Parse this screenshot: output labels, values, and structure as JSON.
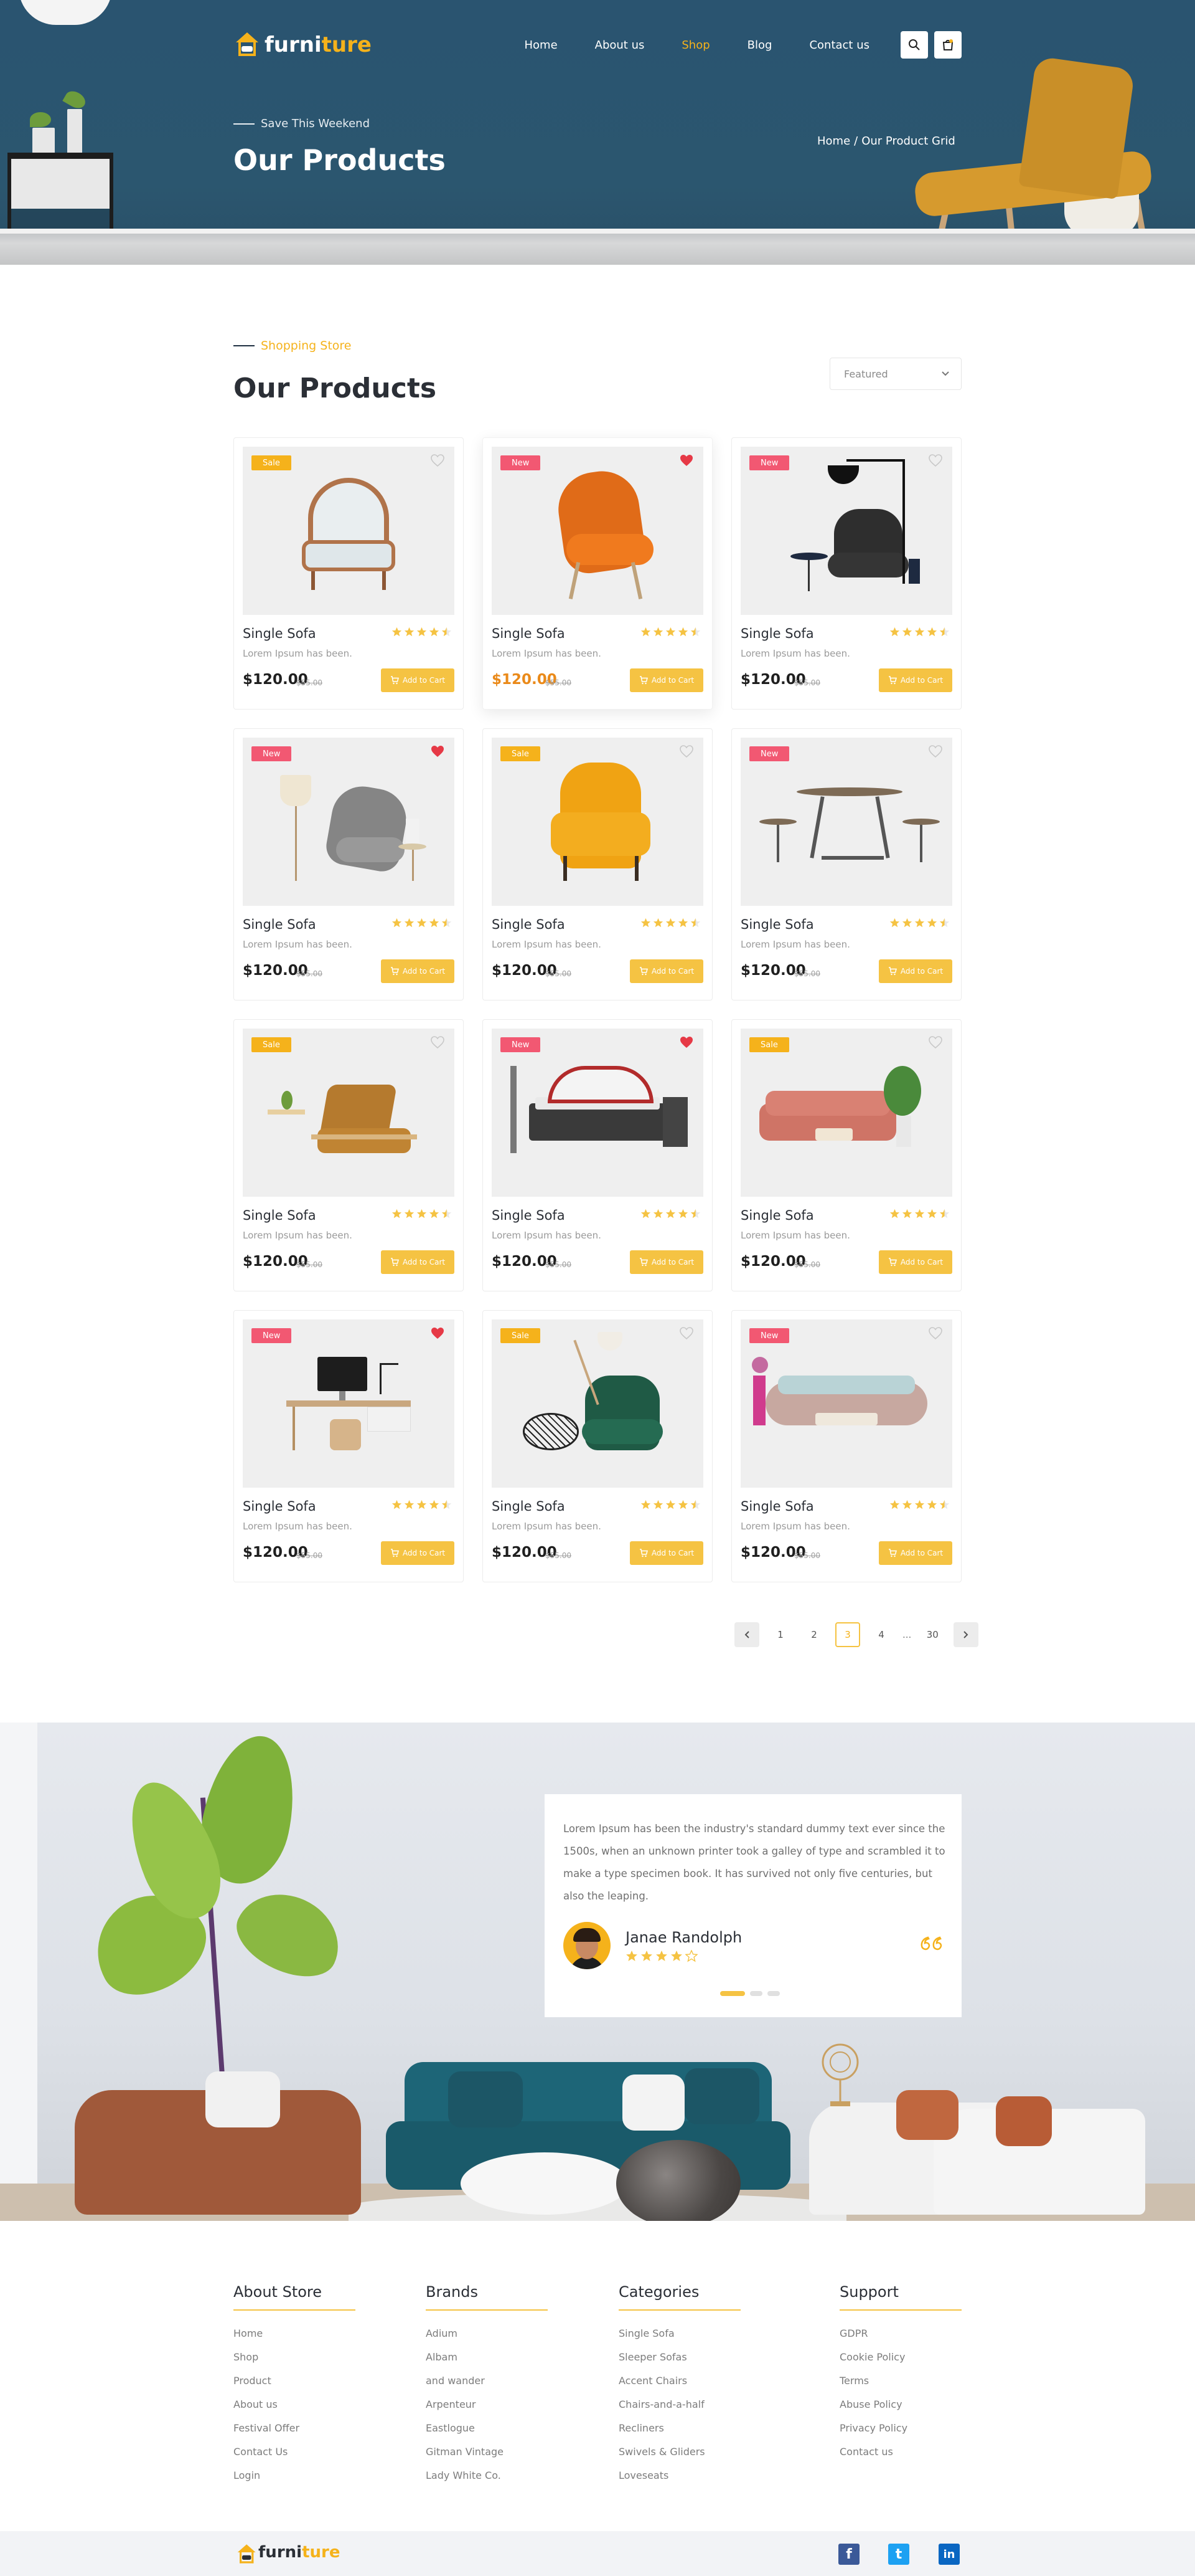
{
  "header": {
    "logo": {
      "part1": "furni",
      "part2": "ture"
    },
    "nav": [
      {
        "label": "Home",
        "active": false
      },
      {
        "label": "About us",
        "active": false
      },
      {
        "label": "Shop",
        "active": true
      },
      {
        "label": "Blog",
        "active": false
      },
      {
        "label": "Contact us",
        "active": false
      }
    ],
    "icons": [
      "search-icon",
      "cart-icon"
    ]
  },
  "hero": {
    "kicker": "Save This Weekend",
    "title": "Our Products",
    "breadcrumb": {
      "home": "Home",
      "separator": "/",
      "current": "Our Product Grid"
    }
  },
  "shop": {
    "kicker": "Shopping Store",
    "title": "Our Products",
    "sort": {
      "selected": "Featured"
    },
    "products": [
      {
        "badge": "Sale",
        "badge_type": "sale",
        "liked": false,
        "name": "Single Sofa",
        "desc": "Lorem Ipsum has been.",
        "price": "$120.00",
        "old_price": "$55.00",
        "rating": 4.5,
        "add_label": "Add to Cart",
        "image": "armchair"
      },
      {
        "badge": "New",
        "badge_type": "new",
        "liked": true,
        "name": "Single Sofa",
        "desc": "Lorem Ipsum has been.",
        "price": "$120.00",
        "old_price": "$55.00",
        "rating": 4.5,
        "add_label": "Add to Cart",
        "image": "orange-chair",
        "highlight": true
      },
      {
        "badge": "New",
        "badge_type": "new",
        "liked": false,
        "name": "Single Sofa",
        "desc": "Lorem Ipsum has been.",
        "price": "$120.00",
        "old_price": "$55.00",
        "rating": 4.5,
        "add_label": "Add to Cart",
        "image": "black-chair"
      },
      {
        "badge": "New",
        "badge_type": "new",
        "liked": true,
        "name": "Single Sofa",
        "desc": "Lorem Ipsum has been.",
        "price": "$120.00",
        "old_price": "$55.00",
        "rating": 4.5,
        "add_label": "Add to Cart",
        "image": "grey-chair"
      },
      {
        "badge": "Sale",
        "badge_type": "sale",
        "liked": false,
        "name": "Single Sofa",
        "desc": "Lorem Ipsum has been.",
        "price": "$120.00",
        "old_price": "$55.00",
        "rating": 4.5,
        "add_label": "Add to Cart",
        "image": "yellow-wingback"
      },
      {
        "badge": "New",
        "badge_type": "new",
        "liked": false,
        "name": "Single Sofa",
        "desc": "Lorem Ipsum has been.",
        "price": "$120.00",
        "old_price": "$55.00",
        "rating": 4.5,
        "add_label": "Add to Cart",
        "image": "table-set"
      },
      {
        "badge": "Sale",
        "badge_type": "sale",
        "liked": false,
        "name": "Single Sofa",
        "desc": "Lorem Ipsum has been.",
        "price": "$120.00",
        "old_price": "$55.00",
        "rating": 4.5,
        "add_label": "Add to Cart",
        "image": "lounge-chair"
      },
      {
        "badge": "New",
        "badge_type": "new",
        "liked": true,
        "name": "Single Sofa",
        "desc": "Lorem Ipsum has been.",
        "price": "$120.00",
        "old_price": "$55.00",
        "rating": 4.5,
        "add_label": "Add to Cart",
        "image": "bed"
      },
      {
        "badge": "Sale",
        "badge_type": "sale",
        "liked": false,
        "name": "Single Sofa",
        "desc": "Lorem Ipsum has been.",
        "price": "$120.00",
        "old_price": "$55.00",
        "rating": 4.5,
        "add_label": "Add to Cart",
        "image": "pink-sofa"
      },
      {
        "badge": "New",
        "badge_type": "new",
        "liked": true,
        "name": "Single Sofa",
        "desc": "Lorem Ipsum has been.",
        "price": "$120.00",
        "old_price": "$55.00",
        "rating": 4.5,
        "add_label": "Add to Cart",
        "image": "desk"
      },
      {
        "badge": "Sale",
        "badge_type": "sale",
        "liked": false,
        "name": "Single Sofa",
        "desc": "Lorem Ipsum has been.",
        "price": "$120.00",
        "old_price": "$55.00",
        "rating": 4.5,
        "add_label": "Add to Cart",
        "image": "green-chair"
      },
      {
        "badge": "New",
        "badge_type": "new",
        "liked": false,
        "name": "Single Sofa",
        "desc": "Lorem Ipsum has been.",
        "price": "$120.00",
        "old_price": "$55.00",
        "rating": 4.5,
        "add_label": "Add to Cart",
        "image": "long-sofa"
      }
    ],
    "pagination": {
      "pages": [
        "1",
        "2",
        "3",
        "4"
      ],
      "ellipsis": "...",
      "last": "30",
      "current": "3"
    }
  },
  "testimonial": {
    "text": "Lorem Ipsum has been the industry's standard dummy text ever since the 1500s, when an unknown printer took a galley of type and scrambled it to make a type specimen book. It has survived not only five centuries, but also the leaping.",
    "name": "Janae Randolph",
    "rating": 4,
    "slides": 3,
    "active_slide": 0
  },
  "footer": {
    "columns": [
      {
        "title": "About Store",
        "links": [
          "Home",
          "Shop",
          "Product",
          "About us",
          "Festival Offer",
          "Contact Us",
          "Login"
        ]
      },
      {
        "title": "Brands",
        "links": [
          "Adium",
          "Albam",
          "and wander",
          "Arpenteur",
          "Eastlogue",
          "Gitman Vintage",
          "Lady White Co."
        ]
      },
      {
        "title": "Categories",
        "links": [
          "Single Sofa",
          "Sleeper Sofas",
          "Accent Chairs",
          "Chairs-and-a-half",
          "Recliners",
          "Swivels & Gliders",
          "Loveseats"
        ]
      },
      {
        "title": "Support",
        "links": [
          "GDPR",
          "Cookie Policy",
          "Terms",
          "Abuse Policy",
          "Privacy Policy",
          "Contact us"
        ]
      }
    ],
    "logo": {
      "part1": "furni",
      "part2": "ture"
    },
    "social": [
      {
        "name": "facebook-icon",
        "glyph": "f",
        "color": "#3b5998"
      },
      {
        "name": "twitter-icon",
        "glyph": "t",
        "color": "#1da1f2"
      },
      {
        "name": "linkedin-icon",
        "glyph": "in",
        "color": "#0a66c2"
      }
    ]
  },
  "colors": {
    "accent": "#f5b21b",
    "button": "#f5c343",
    "new": "#f25872",
    "hero_bg": "#2b566f"
  }
}
